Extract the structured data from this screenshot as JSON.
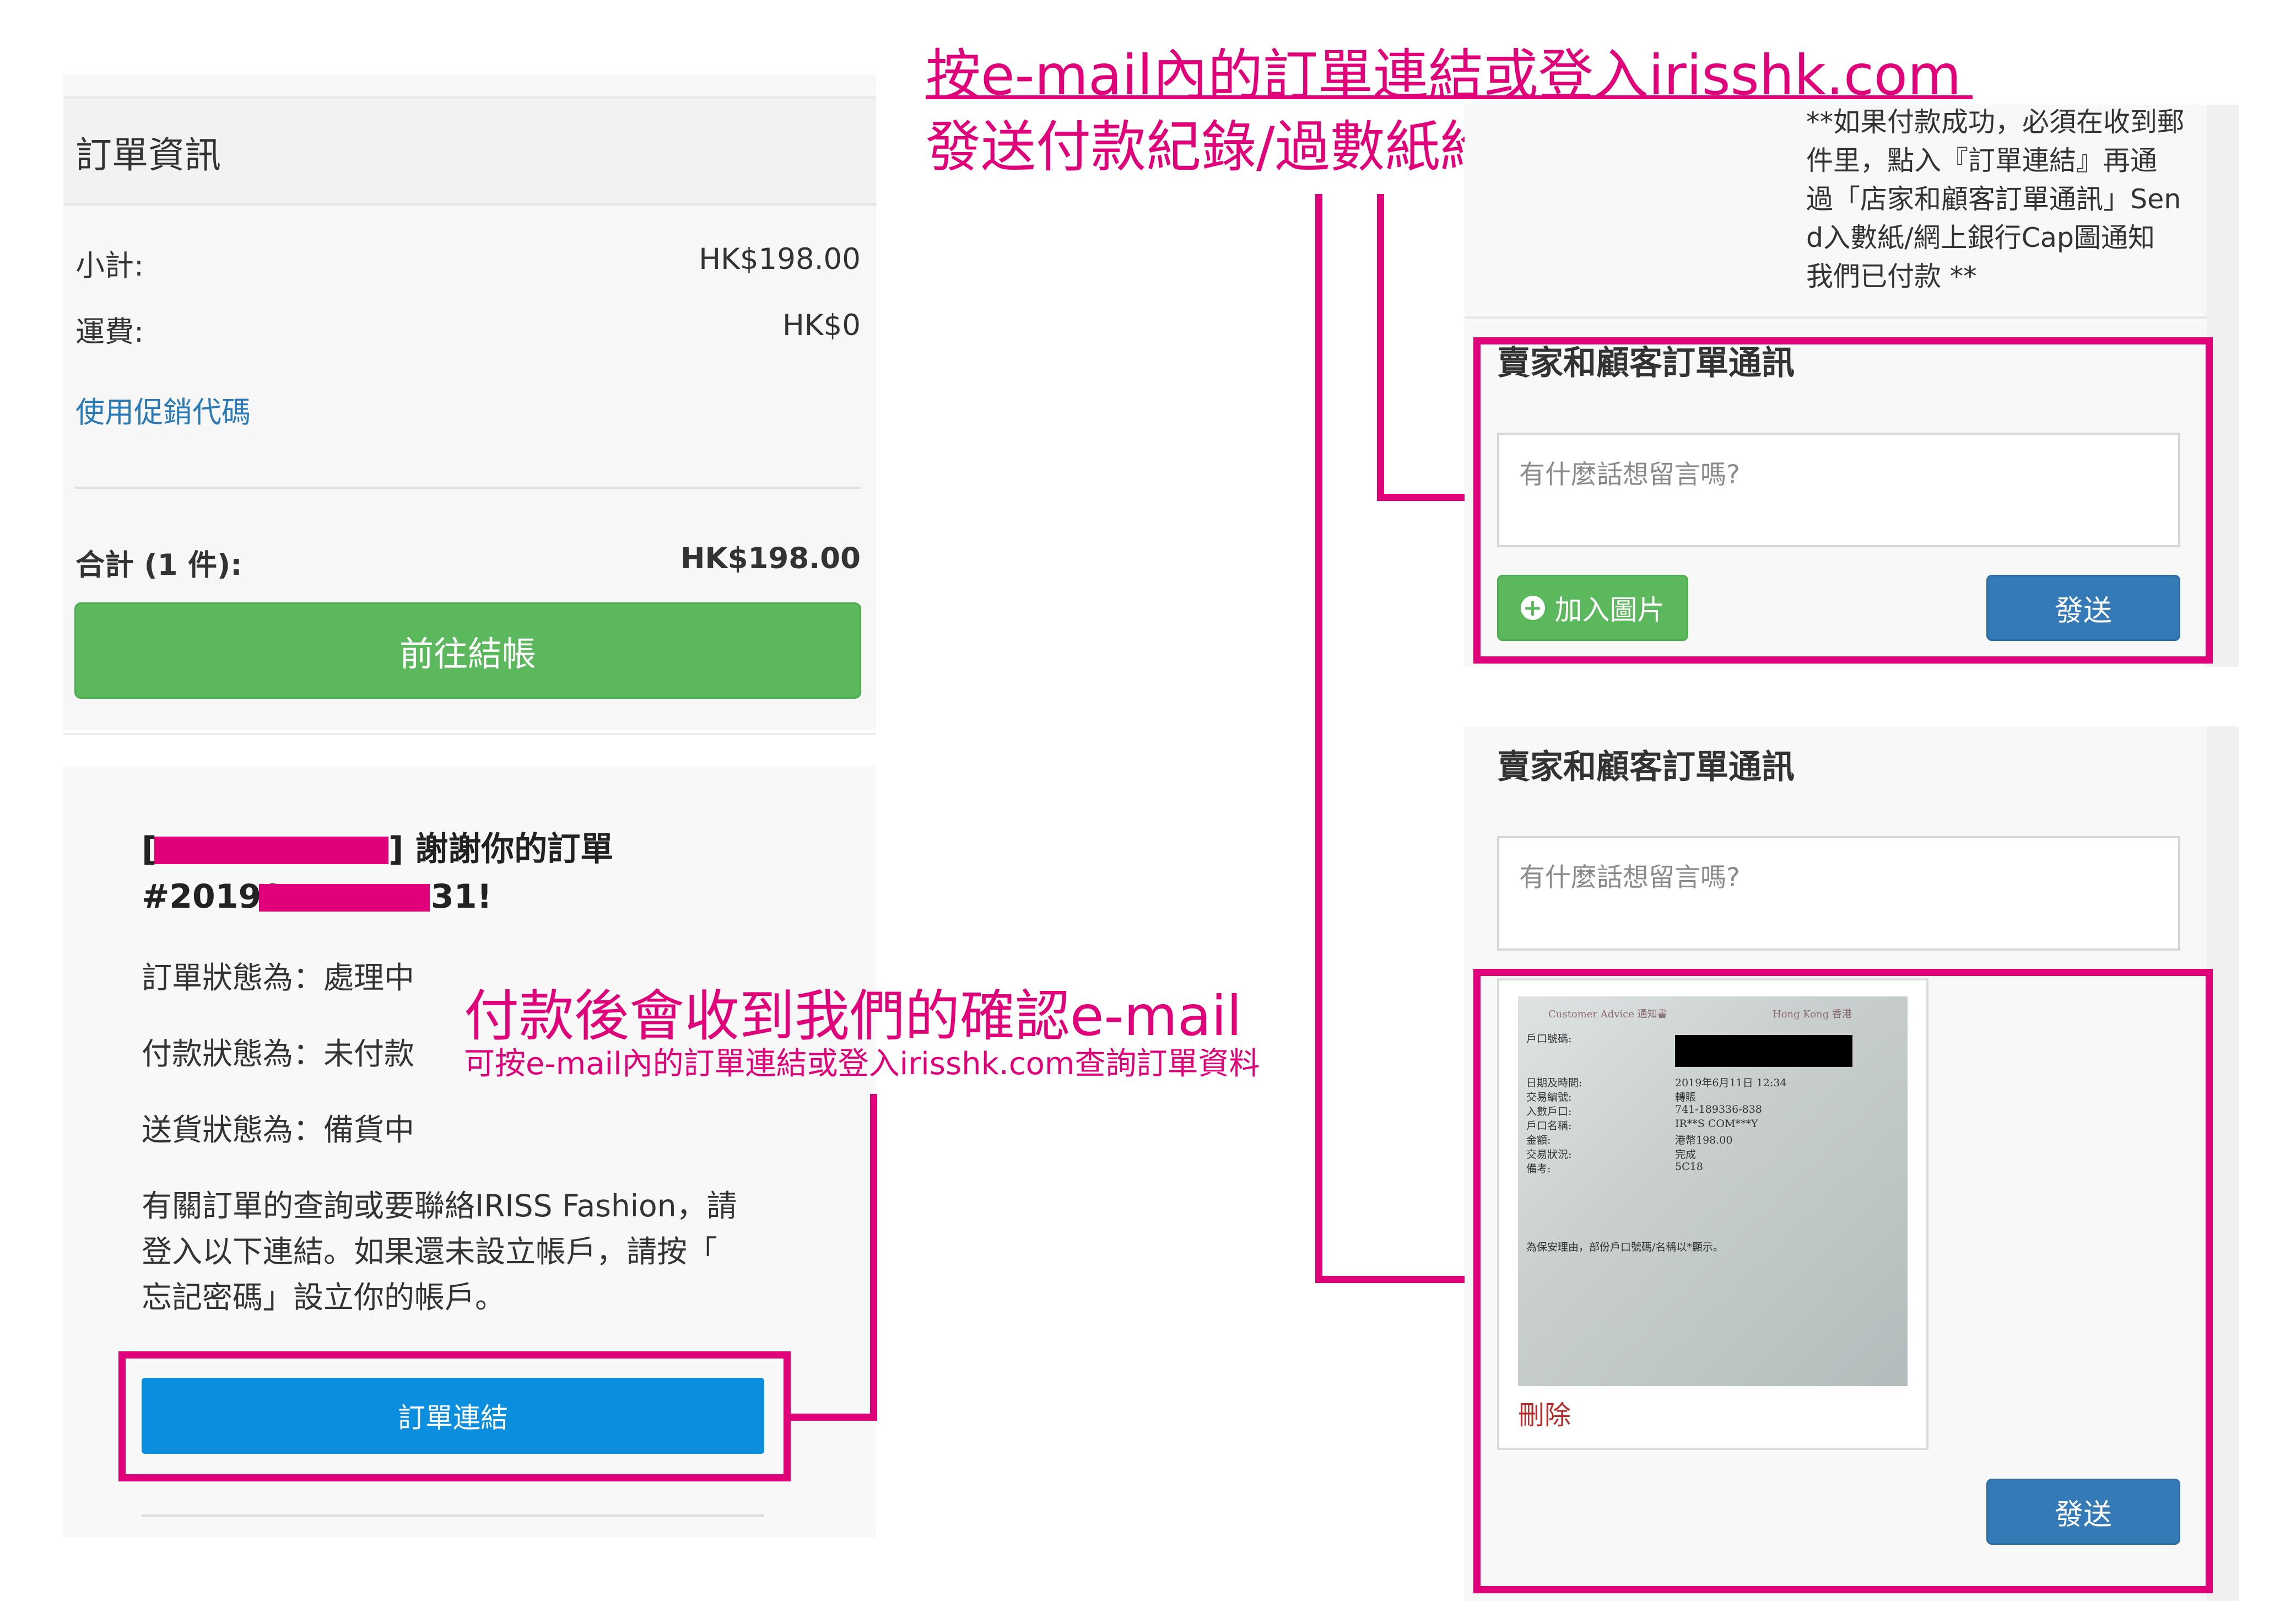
{
  "order_info": {
    "title": "訂單資訊",
    "subtotal_label": "小計:",
    "subtotal_value": "HK$198.00",
    "shipping_label": "運費:",
    "shipping_value": "HK$0",
    "promo_link": "使用促銷代碼",
    "total_label": "合計 (1 件):",
    "total_value": "HK$198.00",
    "checkout_button": "前往結帳"
  },
  "email": {
    "thanks_open": "[",
    "thanks_rest": "] 謝謝你的訂單",
    "order_prefix": "#20190",
    "order_suffix": "31!",
    "order_status": "訂單狀態為：處理中",
    "payment_status": "付款狀態為：未付款",
    "shipping_status": "送貨狀態為：備貨中",
    "inquiry_line1": "有關訂單的查詢或要聯絡IRISS Fashion，請",
    "inquiry_line2": "登入以下連結。如果還未設立帳戶，請按「",
    "inquiry_line3": "忘記密碼」設立你的帳戶。",
    "order_link_button": "訂單連結"
  },
  "annotations": {
    "top_line1": "按e-mail內的訂單連結或登入irisshk.com",
    "top_line2": "發送付款紀錄/過數紙給我們",
    "middle_big": "付款後會收到我們的確認e-mail",
    "middle_small": "可按e-mail內的訂單連結或登入irisshk.com查詢訂單資料"
  },
  "payment_note": {
    "line1": "**如果付款成功，必須在收到郵",
    "line2": "件里，點入『訂單連結』再通",
    "line3": "過「店家和顧客訂單通訊」Sen",
    "line4": "d入數紙/網上銀行Cap圖通知",
    "line5": "我們已付款 **"
  },
  "message_box_1": {
    "title": "賣家和顧客訂單通訊",
    "placeholder": "有什麼話想留言嗎?",
    "add_image_button": "加入圖片",
    "send_button": "發送"
  },
  "message_box_2": {
    "title": "賣家和顧客訂單通訊",
    "placeholder": "有什麼話想留言嗎?",
    "delete_link": "刪除",
    "send_button": "發送"
  },
  "receipt": {
    "header_left": "Customer Advice 通知書",
    "header_right": "Hong Kong 香港",
    "row_labels": [
      "戶口號碼:",
      "日期及時間:",
      "交易編號:",
      "入數戶口:",
      "戶口名稱:",
      "金額:",
      "交易狀況:",
      "備考:"
    ],
    "row_values": [
      "",
      "2019年6月11日 12:34",
      "轉賬",
      "741-189336-838",
      "IR**S COM***Y",
      "港幣198.00",
      "完成",
      "5C18"
    ],
    "footer": "為保安理由，部份戶口號碼/名稱以*顯示。"
  },
  "colors": {
    "annotation": "#e0007a",
    "checkout_green": "#5cb85c",
    "order_link_blue": "#0b8ede",
    "send_blue": "#337ab7",
    "delete_red": "#b52b27",
    "promo_link": "#2a7ab8"
  },
  "icons": [
    "plus-circle-icon"
  ]
}
